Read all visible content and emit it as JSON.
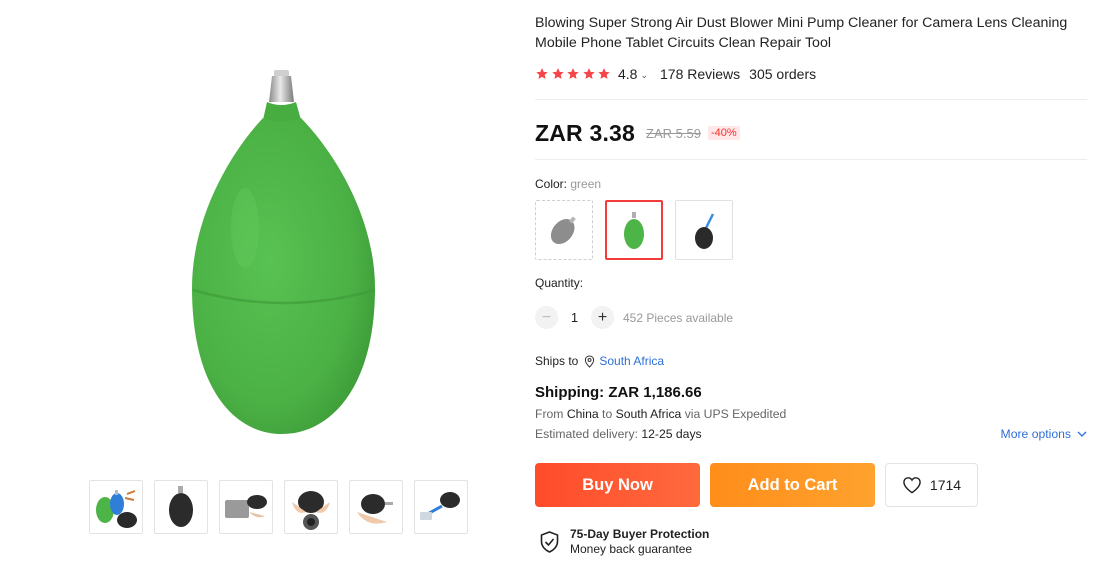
{
  "product": {
    "title": "Blowing Super Strong Air Dust Blower Mini Pump Cleaner for Camera Lens Cleaning Mobile Phone Tablet Circuits Clean Repair Tool",
    "rating": "4.8",
    "rating_chevron": "⌄",
    "stars_filled": 5,
    "reviews": "178 Reviews",
    "orders": "305 orders"
  },
  "price": {
    "current": "ZAR 3.38",
    "original": "ZAR 5.59",
    "discount": "-40%"
  },
  "color": {
    "label": "Color: ",
    "selected_value": "green",
    "options": [
      "gray",
      "green",
      "black"
    ]
  },
  "quantity": {
    "label": "Quantity:",
    "minus": "−",
    "value": "1",
    "plus": "+",
    "available": "452 Pieces available"
  },
  "ships_to": {
    "label": "Ships to",
    "country": "South Africa"
  },
  "shipping": {
    "title": "Shipping: ZAR 1,186.66",
    "from_prefix": "From ",
    "from_country": "China",
    "to_word": " to ",
    "to_country": "South Africa",
    "via": " via UPS Expedited",
    "estimated_label": "Estimated delivery: ",
    "estimated_value": "12-25 days",
    "more_options": "More options"
  },
  "actions": {
    "buy_now": "Buy Now",
    "add_to_cart": "Add to Cart",
    "wishlist_count": "1714"
  },
  "protection": {
    "title": "75-Day Buyer Protection",
    "subtitle": "Money back guarantee"
  },
  "colors": {
    "accent_red": "#f23c3c",
    "buy_now_bg": "#ff4b2b",
    "add_to_cart_bg": "#ff9620",
    "link_blue": "#2e6fd8",
    "product_green": "#4db548"
  },
  "icons": [
    "star-icon",
    "chevron-down-icon",
    "location-pin-icon",
    "heart-icon",
    "shield-check-icon"
  ]
}
